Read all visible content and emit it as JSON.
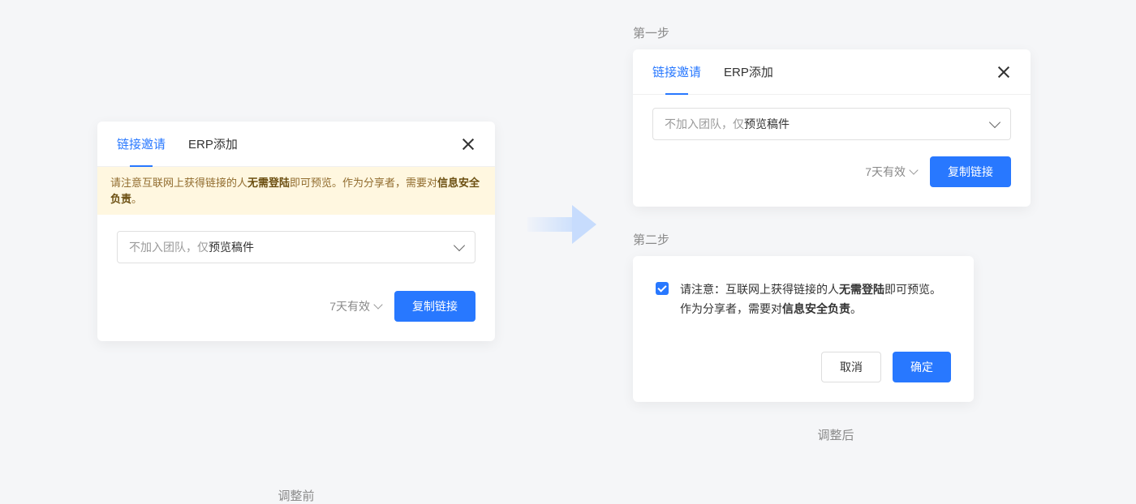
{
  "left": {
    "tabs": {
      "link_invite": "链接邀请",
      "erp_add": "ERP添加"
    },
    "warning": {
      "p1": "请注意互联网上获得链接的人",
      "b1": "无需登陆",
      "p2": "即可预览。作为分享者，需要对",
      "b2": "信息安全负责",
      "p3": "。"
    },
    "select": {
      "prefix": "不加入团队，仅",
      "bold": "预览稿件"
    },
    "expire": "7天有效",
    "copy_btn": "复制链接",
    "caption": "调整前"
  },
  "right": {
    "step1_label": "第一步",
    "step2_label": "第二步",
    "tabs": {
      "link_invite": "链接邀请",
      "erp_add": "ERP添加"
    },
    "select": {
      "prefix": "不加入团队，仅",
      "bold": "预览稿件"
    },
    "expire": "7天有效",
    "copy_btn": "复制链接",
    "confirm": {
      "p1": "请注意：互联网上获得链接的人",
      "b1": "无需登陆",
      "p2": "即可预览。",
      "p3": "作为分享者，需要对",
      "b2": "信息安全负责",
      "p4": "。"
    },
    "cancel": "取消",
    "ok": "确定",
    "caption": "调整后"
  }
}
